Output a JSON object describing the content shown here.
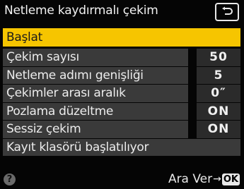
{
  "header": {
    "title": "Netleme kaydırmalı çekim"
  },
  "menu": {
    "items": [
      {
        "label": "Başlat",
        "value": null
      },
      {
        "label": "Çekim sayısı",
        "value": "50"
      },
      {
        "label": "Netleme adımı genişliği",
        "value": "5"
      },
      {
        "label": "Çekimler arası aralık",
        "value": "0″"
      },
      {
        "label": "Pozlama düzeltme",
        "value": "ON"
      },
      {
        "label": "Sessiz çekim",
        "value": "ON"
      },
      {
        "label": "Kayıt klasörü başlatılıyor",
        "value": null
      }
    ]
  },
  "footer": {
    "help_symbol": "?",
    "pause_label": "Ara Ver",
    "arrow": "→",
    "ok_label": "OK"
  },
  "colors": {
    "highlight": "#f6c500",
    "row_bg": "#3a3a3a",
    "value_bg": "#2b2b2b",
    "background": "#050505"
  }
}
